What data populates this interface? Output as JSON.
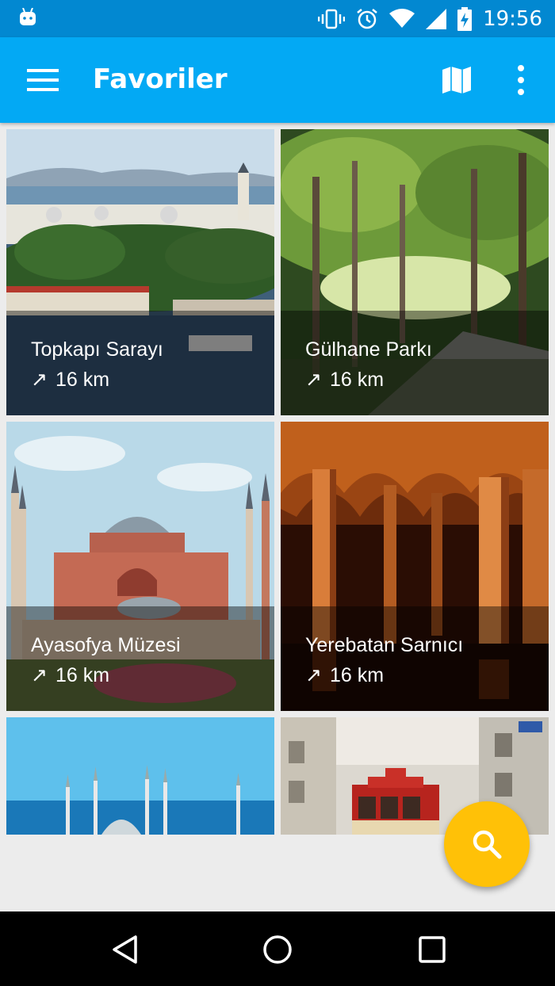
{
  "status_bar": {
    "time": "19:56"
  },
  "app_bar": {
    "title": "Favoriler"
  },
  "places": [
    {
      "name": "Topkapı Sarayı",
      "distance": "16 km",
      "arrow": "↗"
    },
    {
      "name": "Gülhane Parkı",
      "distance": "16 km",
      "arrow": "↗"
    },
    {
      "name": "Ayasofya Müzesi",
      "distance": "16 km",
      "arrow": "↗"
    },
    {
      "name": "Yerebatan Sarnıcı",
      "distance": "16 km",
      "arrow": "↗"
    }
  ],
  "colors": {
    "status_bar": "#0288d1",
    "app_bar": "#03a9f4",
    "fab": "#ffc107",
    "nav_bar": "#000000"
  },
  "icons": {
    "menu": "menu-icon",
    "map": "map-icon",
    "more": "more-vert-icon",
    "fab": "search-icon"
  }
}
